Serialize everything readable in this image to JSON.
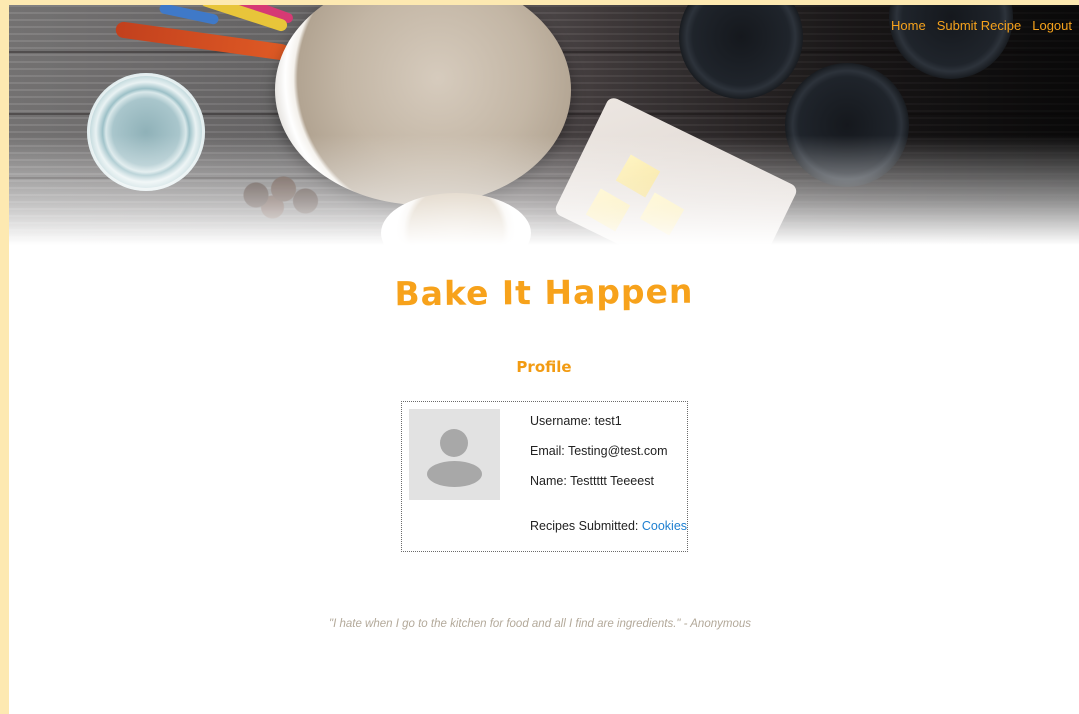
{
  "nav": {
    "items": [
      {
        "label": "Home"
      },
      {
        "label": "Submit Recipe"
      },
      {
        "label": "Logout"
      }
    ]
  },
  "site": {
    "title": "Bake It Happen"
  },
  "profile": {
    "heading": "Profile",
    "username_label": "Username:",
    "username": "test1",
    "email_label": "Email:",
    "email": "Testing@test.com",
    "name_label": "Name:",
    "name": "Testtttt Teeeest",
    "recipes_label": "Recipes Submitted:",
    "recipes": [
      "Cookies"
    ]
  },
  "footer": {
    "quote": "\"I hate when I go to the kitchen for food and all I find are ingredients.\" - Anonymous"
  },
  "colors": {
    "accent": "#f7a21b",
    "link": "#1e7fd0",
    "quote": "#b3a99a",
    "frame": "#fde9b1"
  },
  "icons": {
    "avatar": "user-placeholder-icon"
  }
}
